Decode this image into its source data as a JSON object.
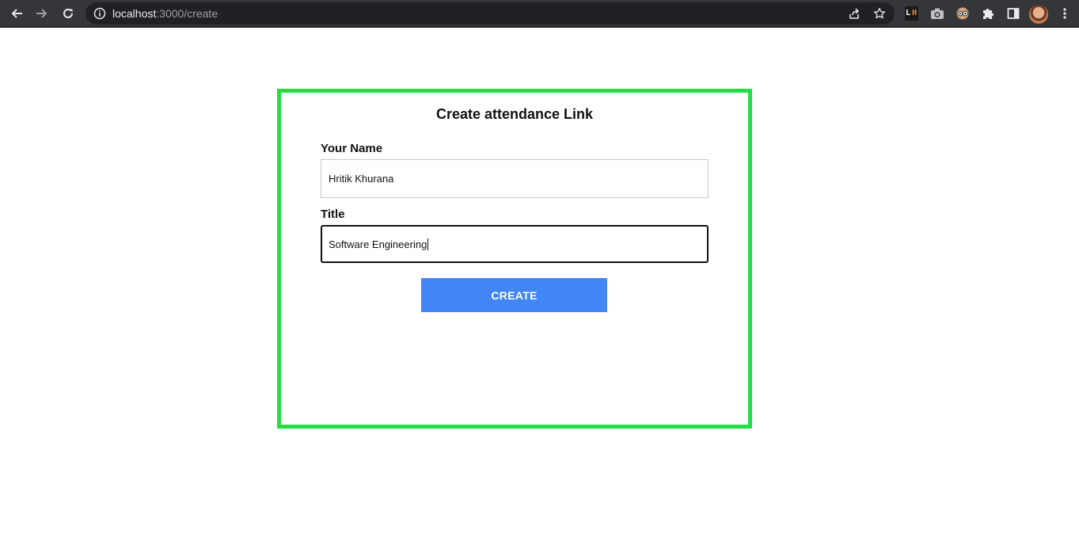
{
  "browser": {
    "address_bar": {
      "host": "localhost",
      "path": ":3000/create"
    },
    "extensions": {
      "lighthouse_letters": [
        "L",
        "H"
      ]
    },
    "colors": {
      "toolbar": "#35363a",
      "omnibox": "#202124"
    }
  },
  "page": {
    "title": "Create attendance Link",
    "name_field": {
      "label": "Your Name",
      "value": "Hritik Khurana"
    },
    "title_field": {
      "label": "Title",
      "value": "Software Engineering"
    },
    "create_button": {
      "label": "CREATE"
    },
    "colors": {
      "card_border": "#22dd44",
      "button": "#4285f4"
    }
  },
  "icons": [
    "back-arrow-icon",
    "forward-arrow-icon",
    "reload-icon",
    "info-icon",
    "share-icon",
    "star-icon",
    "lighthouse-icon",
    "camera-icon",
    "eyes-extension-icon",
    "puzzle-icon",
    "side-panel-icon",
    "avatar",
    "kebab-menu-icon"
  ]
}
